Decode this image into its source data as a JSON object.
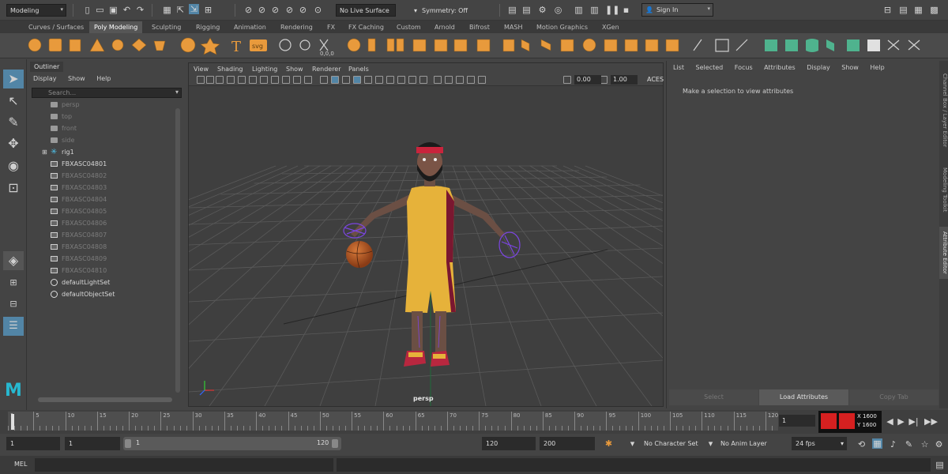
{
  "status_line": {
    "menu_set": "Modeling",
    "live_surface": "No Live Surface",
    "symmetry": "Symmetry: Off",
    "sign_in": "Sign In"
  },
  "shelf_tabs": [
    "Curves / Surfaces",
    "Poly Modeling",
    "Sculpting",
    "Rigging",
    "Animation",
    "Rendering",
    "FX",
    "FX Caching",
    "Custom",
    "Arnold",
    "Bifrost",
    "MASH",
    "Motion Graphics",
    "XGen"
  ],
  "active_shelf_tab": "Poly Modeling",
  "outliner": {
    "tab_label": "Outliner",
    "menus": [
      "Display",
      "Show",
      "Help"
    ],
    "search_placeholder": "Search...",
    "items": [
      {
        "label": "persp",
        "icon": "camera-icon",
        "dim": true
      },
      {
        "label": "top",
        "icon": "camera-icon",
        "dim": true
      },
      {
        "label": "front",
        "icon": "camera-icon",
        "dim": true
      },
      {
        "label": "side",
        "icon": "camera-icon",
        "dim": true
      },
      {
        "label": "rig1",
        "icon": "joint-icon",
        "dim": false,
        "expandable": true
      },
      {
        "label": "FBXASC04801",
        "icon": "mesh-icon",
        "dim": false
      },
      {
        "label": "FBXASC04802",
        "icon": "mesh-icon",
        "dim": true
      },
      {
        "label": "FBXASC04803",
        "icon": "mesh-icon",
        "dim": true
      },
      {
        "label": "FBXASC04804",
        "icon": "mesh-icon",
        "dim": true
      },
      {
        "label": "FBXASC04805",
        "icon": "mesh-icon",
        "dim": true
      },
      {
        "label": "FBXASC04806",
        "icon": "mesh-icon",
        "dim": true
      },
      {
        "label": "FBXASC04807",
        "icon": "mesh-icon",
        "dim": true
      },
      {
        "label": "FBXASC04808",
        "icon": "mesh-icon",
        "dim": true
      },
      {
        "label": "FBXASC04809",
        "icon": "mesh-icon",
        "dim": true
      },
      {
        "label": "FBXASC04810",
        "icon": "mesh-icon",
        "dim": true
      },
      {
        "label": "defaultLightSet",
        "icon": "set-icon",
        "dim": false
      },
      {
        "label": "defaultObjectSet",
        "icon": "set-icon",
        "dim": false
      }
    ]
  },
  "viewport": {
    "menus": [
      "View",
      "Shading",
      "Lighting",
      "Show",
      "Renderer",
      "Panels"
    ],
    "exposure": "0.00",
    "gamma": "1.00",
    "color_space": "ACES",
    "camera_label": "persp"
  },
  "attribute_editor": {
    "menus": [
      "List",
      "Selected",
      "Focus",
      "Attributes",
      "Display",
      "Show",
      "Help"
    ],
    "message": "Make a selection to view attributes",
    "buttons": [
      "Select",
      "Load Attributes",
      "Copy Tab"
    ],
    "side_tabs": [
      "Channel Box / Layer Editor",
      "Modeling Toolkit",
      "Attribute Editor"
    ]
  },
  "time_slider": {
    "ticks": [
      "1",
      "5",
      "10",
      "15",
      "20",
      "25",
      "30",
      "35",
      "40",
      "45",
      "50",
      "55",
      "60",
      "65",
      "70",
      "75",
      "80",
      "85",
      "90",
      "95",
      "100",
      "105",
      "110",
      "115",
      "120"
    ],
    "current_frame": "1",
    "hud_x": "X 1600",
    "hud_y": "Y 1600"
  },
  "range_slider": {
    "start": "1",
    "playback_start": "1",
    "range_start_label": "1",
    "range_end_label": "120",
    "playback_end": "120",
    "end": "200",
    "character_set": "No Character Set",
    "anim_layer": "No Anim Layer",
    "fps": "24 fps"
  },
  "command_line": {
    "language": "MEL"
  },
  "colors": {
    "accent_blue": "#5285a6",
    "shelf_orange": "#e89a3c",
    "shelf_green": "#4fb38e",
    "grid_line": "#5a5a5a"
  }
}
